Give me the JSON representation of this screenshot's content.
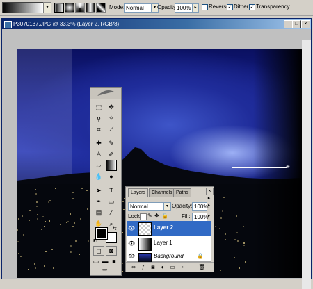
{
  "options_bar": {
    "mode_label": "Mode:",
    "mode_value": "Normal",
    "opacity_label": "Opacity:",
    "opacity_value": "100%",
    "reverse_label": "Reverse",
    "dither_label": "Dither",
    "transparency_label": "Transparency",
    "reverse_checked": false,
    "dither_checked": true,
    "transparency_checked": true
  },
  "document": {
    "title": "P3070137.JPG @ 33.3% (Layer 2, RGB/8)",
    "minimize_glyph": "_",
    "maximize_glyph": "□",
    "close_glyph": "×"
  },
  "layers_palette": {
    "tabs": [
      "Layers",
      "Channels",
      "Paths"
    ],
    "active_tab": "Layers",
    "blend_mode": "Normal",
    "opacity_label": "Opacity:",
    "opacity_value": "100%",
    "lock_label": "Lock:",
    "fill_label": "Fill:",
    "fill_value": "100%",
    "layers": [
      {
        "name": "Layer 2",
        "visible": true,
        "selected": true
      },
      {
        "name": "Layer 1",
        "visible": true,
        "selected": false
      },
      {
        "name": "Background",
        "visible": true,
        "selected": false,
        "locked": true
      }
    ],
    "close_glyph": "×",
    "menu_glyph": "▸"
  },
  "colors": {
    "selection": "#316ac5",
    "title_bar": "#0a246a",
    "panel": "#d4d0c8"
  }
}
